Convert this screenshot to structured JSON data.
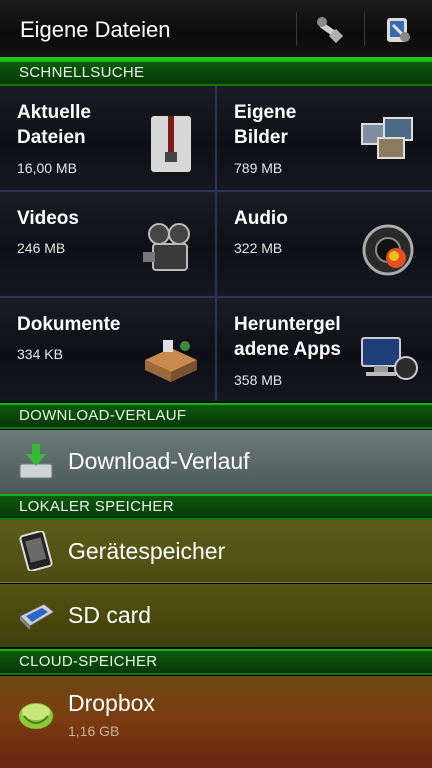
{
  "header": {
    "title": "Eigene Dateien"
  },
  "sections": {
    "quick_search": "SCHNELLSUCHE",
    "download_history": "DOWNLOAD-VERLAUF",
    "local_storage": "LOKALER SPEICHER",
    "cloud_storage": "CLOUD-SPEICHER"
  },
  "tiles": [
    {
      "line1": "Aktuelle",
      "line2": "Dateien",
      "size": "16,00 MB",
      "icon": "zip-archive-icon"
    },
    {
      "line1": "Eigene",
      "line2": "Bilder",
      "size": "789 MB",
      "icon": "photos-icon"
    },
    {
      "line1": "Videos",
      "line2": "",
      "size": "246 MB",
      "icon": "video-camera-icon"
    },
    {
      "line1": "Audio",
      "line2": "",
      "size": "322 MB",
      "icon": "speaker-icon"
    },
    {
      "line1": "Dokumente",
      "line2": "",
      "size": "334 KB",
      "icon": "office-desk-icon"
    },
    {
      "line1": "Heruntergel",
      "line2": "adene Apps",
      "size": "358 MB",
      "icon": "computer-icon"
    }
  ],
  "rows": {
    "download": {
      "label": "Download-Verlauf",
      "icon": "download-icon"
    },
    "device": {
      "label": "Gerätespeicher",
      "icon": "phone-icon"
    },
    "sd": {
      "label": "SD card",
      "icon": "sd-card-icon"
    },
    "dropbox": {
      "label": "Dropbox",
      "sub": "1,16 GB",
      "icon": "dropbox-icon"
    }
  },
  "colors": {
    "accent": "#1fc41f",
    "section_bg": "#0a4a0a",
    "tile_bg": "#12141d"
  }
}
